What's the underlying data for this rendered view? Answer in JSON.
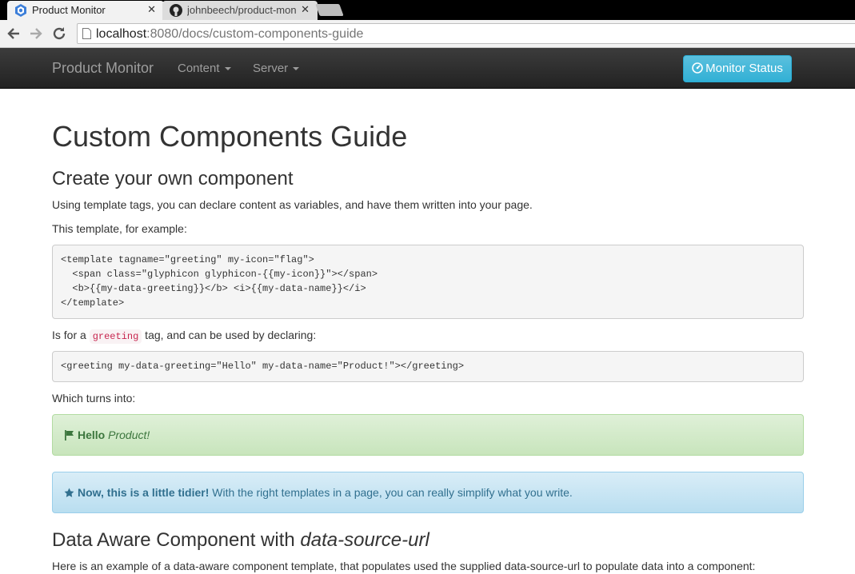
{
  "browser": {
    "tabs": [
      {
        "title": "Product Monitor",
        "active": true
      },
      {
        "title": "johnbeech/product-monitor",
        "active": false
      }
    ],
    "url_host": "localhost",
    "url_path": ":8080/docs/custom-components-guide"
  },
  "navbar": {
    "brand": "Product Monitor",
    "menus": [
      "Content",
      "Server"
    ],
    "status_button": "Monitor Status"
  },
  "page": {
    "title": "Custom Components Guide",
    "section1": {
      "heading": "Create your own component",
      "intro": "Using template tags, you can declare content as variables, and have them written into your page.",
      "example_label": "This template, for example:",
      "template_code": "<template tagname=\"greeting\" my-icon=\"flag\">\n  <span class=\"glyphicon glyphicon-{{my-icon}}\"></span>\n  <b>{{my-data-greeting}}</b> <i>{{my-data-name}}</i>\n</template>",
      "usage_before": "Is for a ",
      "usage_tag": "greeting",
      "usage_after": " tag, and can be used by declaring:",
      "usage_code": "<greeting my-data-greeting=\"Hello\" my-data-name=\"Product!\"></greeting>",
      "turns_into": "Which turns into:",
      "result_greeting": "Hello",
      "result_name": "Product!",
      "tip_bold": "Now, this is a little tidier!",
      "tip_text": " With the right templates in a page, you can really simplify what you write."
    },
    "section2": {
      "heading_plain": "Data Aware Component with ",
      "heading_italic": "data-source-url",
      "intro": "Here is an example of a data-aware component template, that populates used the supplied data-source-url to populate data into a component:"
    }
  },
  "colors": {
    "navbar": "#222222",
    "info_button": "#5bc0de",
    "success_text": "#3c763d",
    "info_text": "#31708f"
  }
}
